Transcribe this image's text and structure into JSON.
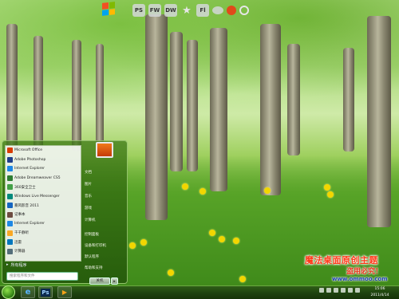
{
  "dock": {
    "items": [
      {
        "icon": "photoshop-icon",
        "label": "PS"
      },
      {
        "icon": "fireworks-icon",
        "label": "FW"
      },
      {
        "icon": "dreamweaver-icon",
        "label": "DW"
      },
      {
        "icon": "star-icon",
        "label": "★"
      },
      {
        "icon": "flash-icon",
        "label": "Fl"
      },
      {
        "icon": "cloud-icon",
        "label": ""
      },
      {
        "icon": "globe-icon",
        "label": ""
      },
      {
        "icon": "refresh-icon",
        "label": ""
      },
      {
        "icon": "shield-icon",
        "label": ""
      }
    ]
  },
  "start_menu": {
    "programs": [
      {
        "label": "Microsoft Office",
        "color": "#d83b01"
      },
      {
        "label": "Adobe Photoshop",
        "color": "#1f3f8a"
      },
      {
        "label": "Internet Explorer",
        "color": "#1e88e5"
      },
      {
        "label": "Adobe Dreamweaver CS5",
        "color": "#2e7d32"
      },
      {
        "label": "360安全卫士",
        "color": "#43a047"
      },
      {
        "label": "Windows Live Messenger",
        "color": "#00897b"
      },
      {
        "label": "暴风影音 2011",
        "color": "#1565c0"
      },
      {
        "label": "记事本",
        "color": "#6d4c41"
      },
      {
        "label": "Internet Explorer",
        "color": "#1e88e5"
      },
      {
        "label": "千千静听",
        "color": "#f9a825"
      },
      {
        "label": "迅雷",
        "color": "#0277bd"
      },
      {
        "label": "计算器",
        "color": "#546e7a"
      }
    ],
    "all_programs": "所有程序",
    "search_placeholder": "搜索程序和文件",
    "right_items": [
      "文档",
      "图片",
      "音乐",
      "游戏",
      "计算机",
      "控制面板",
      "设备和打印机",
      "默认程序",
      "帮助和支持"
    ],
    "shutdown": "关机",
    "shutdown_arrow": "▸"
  },
  "taskbar": {
    "pinned": [
      {
        "icon": "ie-icon",
        "label": "e"
      },
      {
        "icon": "photoshop-icon",
        "label": "Ps"
      },
      {
        "icon": "media-icon",
        "label": "▶"
      }
    ],
    "clock_time": "15:06",
    "clock_date": "2011/4/14"
  },
  "watermark": {
    "title": "魔法桌面原创主题",
    "subtitle": "盗用必究！",
    "url": "www.ommoo.com"
  },
  "colors": {
    "accent": "#3f8a1a",
    "flower": "#f2d600",
    "watermark_red": "#ff3b1a"
  }
}
